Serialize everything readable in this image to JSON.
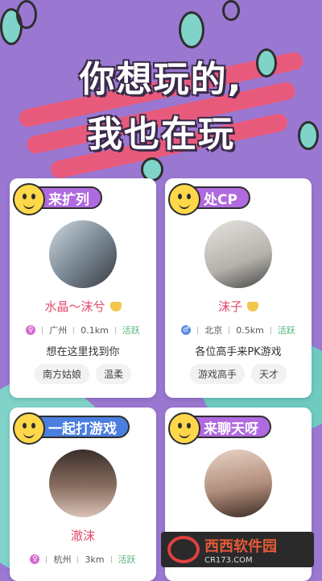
{
  "headline": {
    "line1": "你想玩的,",
    "line2": "我也在玩"
  },
  "colors": {
    "background": "#9a78d2",
    "accent_pink": "#e85a7c",
    "accent_green": "#7fd3c9"
  },
  "cards": [
    {
      "tag": "来扩列",
      "tag_color": "#b06adf",
      "name": "水晶～沫兮",
      "gender_icon": "female-icon",
      "city": "广州",
      "distance": "0.1km",
      "status": "活跃",
      "bio": "想在这里找到你",
      "chips": [
        "南方姑娘",
        "温柔"
      ]
    },
    {
      "tag": "处CP",
      "tag_color": "#b06adf",
      "name": "沫子",
      "gender_icon": "male-icon",
      "city": "北京",
      "distance": "0.5km",
      "status": "活跃",
      "bio": "各位高手来PK游戏",
      "chips": [
        "游戏高手",
        "天才"
      ]
    },
    {
      "tag": "一起打游戏",
      "tag_color": "#4a7fe0",
      "name": "澈沫",
      "gender_icon": "female-icon",
      "city": "杭州",
      "distance": "3km",
      "status": "活跃"
    },
    {
      "tag": "来聊天呀",
      "tag_color": "#b06adf"
    }
  ],
  "watermark": {
    "brand": "西西软件园",
    "url": "CR173.COM"
  }
}
